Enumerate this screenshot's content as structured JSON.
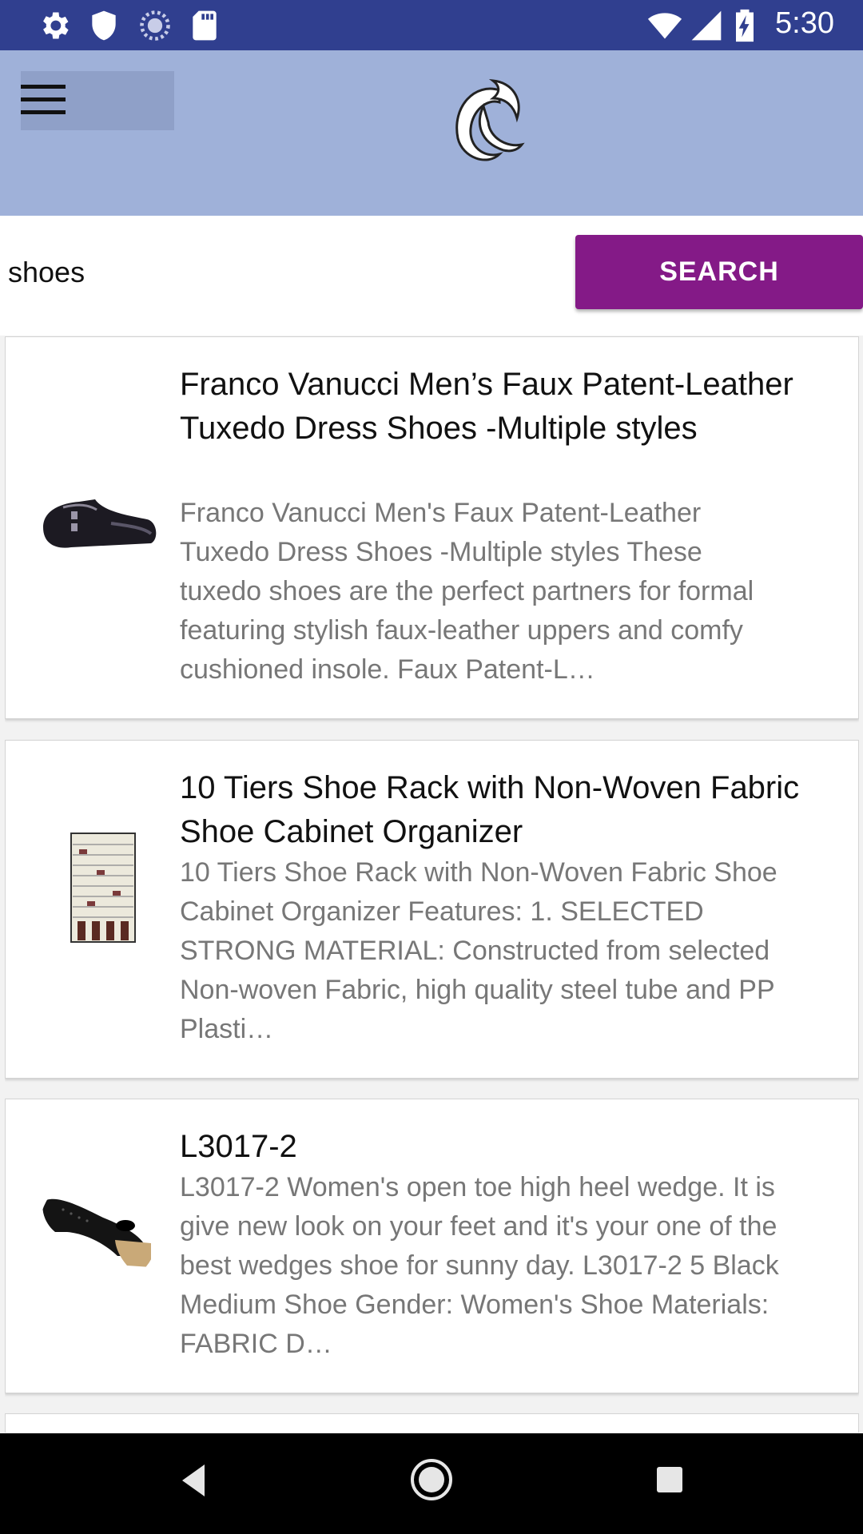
{
  "status_bar": {
    "time": "5:30",
    "left_icons": [
      "gear-icon",
      "shield-icon",
      "sync-icon",
      "sd-card-icon"
    ],
    "right_icons": [
      "wifi-icon",
      "signal-icon",
      "battery-charging-icon"
    ]
  },
  "header": {
    "menu_icon": "hamburger-menu-icon",
    "logo": "app-logo"
  },
  "search": {
    "value": "shoes",
    "button_label": "SEARCH",
    "button_color": "#841a87"
  },
  "results": [
    {
      "title": "Franco Vanucci Men’s Faux Patent-Leather Tuxedo Dress Shoes -Multiple styles",
      "description": "Franco Vanucci Men's Faux Patent-Leather Tuxedo Dress Shoes -Multiple styles These tuxedo shoes are the perfect partners for formal featuring stylish faux-leather uppers and comfy cushioned insole. Faux Patent-L…",
      "image": "dress-shoe-thumbnail"
    },
    {
      "title": "10 Tiers Shoe Rack with Non-Woven Fabric Shoe Cabinet Organizer",
      "description": "10 Tiers Shoe Rack with Non-Woven Fabric Shoe Cabinet Organizer Features: 1. SELECTED STRONG MATERIAL: Constructed from selected Non-woven Fabric, high quality steel tube and PP Plasti…",
      "image": "shoe-rack-thumbnail"
    },
    {
      "title": "L3017-2",
      "description": "L3017-2 Women's open toe high heel wedge. It is give new look on your feet and it's your one of the best wedges shoe for sunny day. L3017-2 5 Black Medium Shoe Gender: Women's Shoe Materials: FABRIC D…",
      "image": "wedge-shoe-thumbnail"
    }
  ],
  "nav_bar": {
    "buttons": [
      "back-icon",
      "home-icon",
      "recents-icon"
    ]
  }
}
